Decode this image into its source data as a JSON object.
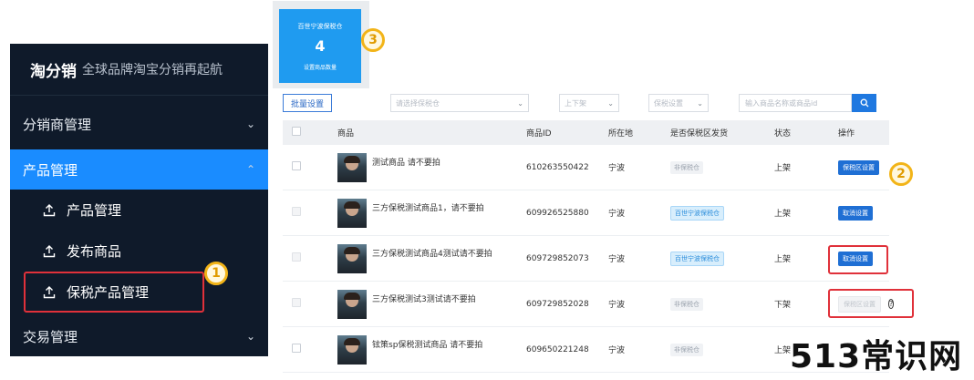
{
  "sidebar": {
    "brand_name": "淘分销",
    "brand_slogan": "全球品牌淘宝分销再起航",
    "groups": {
      "distributor": "分销商管理",
      "product": "产品管理",
      "trade": "交易管理"
    },
    "sub_items": [
      "产品管理",
      "发布商品",
      "保税产品管理"
    ]
  },
  "annotations": [
    "1",
    "2",
    "3"
  ],
  "card": {
    "title": "百世宁波保税仓",
    "value": "4",
    "label": "设置商品数量"
  },
  "toolbar": {
    "batch_label": "批量设置",
    "warehouse_placeholder": "请选择保税仓",
    "shelf_placeholder": "上下架",
    "bonded_placeholder": "保税设置",
    "search_placeholder": "输入商品名称或商品id"
  },
  "table": {
    "headers": [
      "商品",
      "商品ID",
      "所在地",
      "是否保税区发货",
      "状态",
      "操作"
    ],
    "rows": [
      {
        "name": "测试商品 请不要拍",
        "id": "610263550422",
        "loc": "宁波",
        "bonded": "非保税仓",
        "status": "上架",
        "op": "保税区设置"
      },
      {
        "name": "三方保税测试商品1，请不要拍",
        "id": "609926525880",
        "loc": "宁波",
        "bonded": "百世宁波保税仓",
        "status": "上架",
        "op": "取消设置"
      },
      {
        "name": "三方保税测试商品4测试请不要拍",
        "id": "609729852073",
        "loc": "宁波",
        "bonded": "百世宁波保税仓",
        "status": "上架",
        "op": "取消设置"
      },
      {
        "name": "三方保税测试3测试请不要拍",
        "id": "609729852028",
        "loc": "宁波",
        "bonded": "非保税仓",
        "status": "下架",
        "op": "保税区设置"
      },
      {
        "name": "铉策sp保税测试商品 请不要拍",
        "id": "609650221248",
        "loc": "宁波",
        "bonded": "非保税仓",
        "status": "上架",
        "op": ""
      }
    ]
  },
  "watermark": "513常识网",
  "colors": {
    "sidebar_bg": "#0f1a2a",
    "accent": "#1a8cff",
    "highlight": "#e0313a",
    "badge": "#f2b418"
  }
}
